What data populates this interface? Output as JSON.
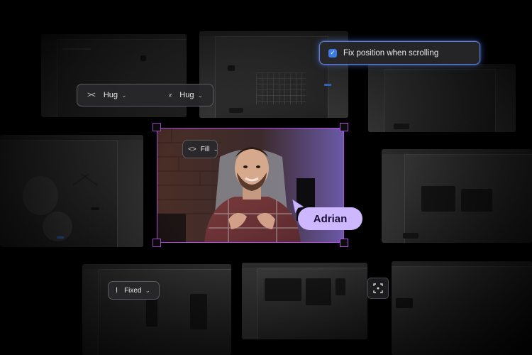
{
  "hug_control": {
    "horizontal_label": "Hug",
    "vertical_label": "Hug"
  },
  "fill_control": {
    "label": "Fill"
  },
  "fixed_control": {
    "label": "Fixed"
  },
  "fix_position_option": {
    "label": "Fix position when scrolling",
    "checked": true
  },
  "video": {
    "person_name": "Adrian"
  },
  "colors": {
    "selection": "#b34fe6",
    "name_badge": "#cdb8ff",
    "checkbox": "#3d7be6",
    "glow": "#5b7fd8"
  },
  "icons": {
    "hug_horizontal": "horizontal-hug-icon",
    "hug_vertical": "vertical-hug-icon",
    "fill": "code-brackets-icon",
    "fixed": "text-cursor-icon",
    "focus": "focus-frame-icon",
    "cursor": "pointer-cursor-icon"
  }
}
